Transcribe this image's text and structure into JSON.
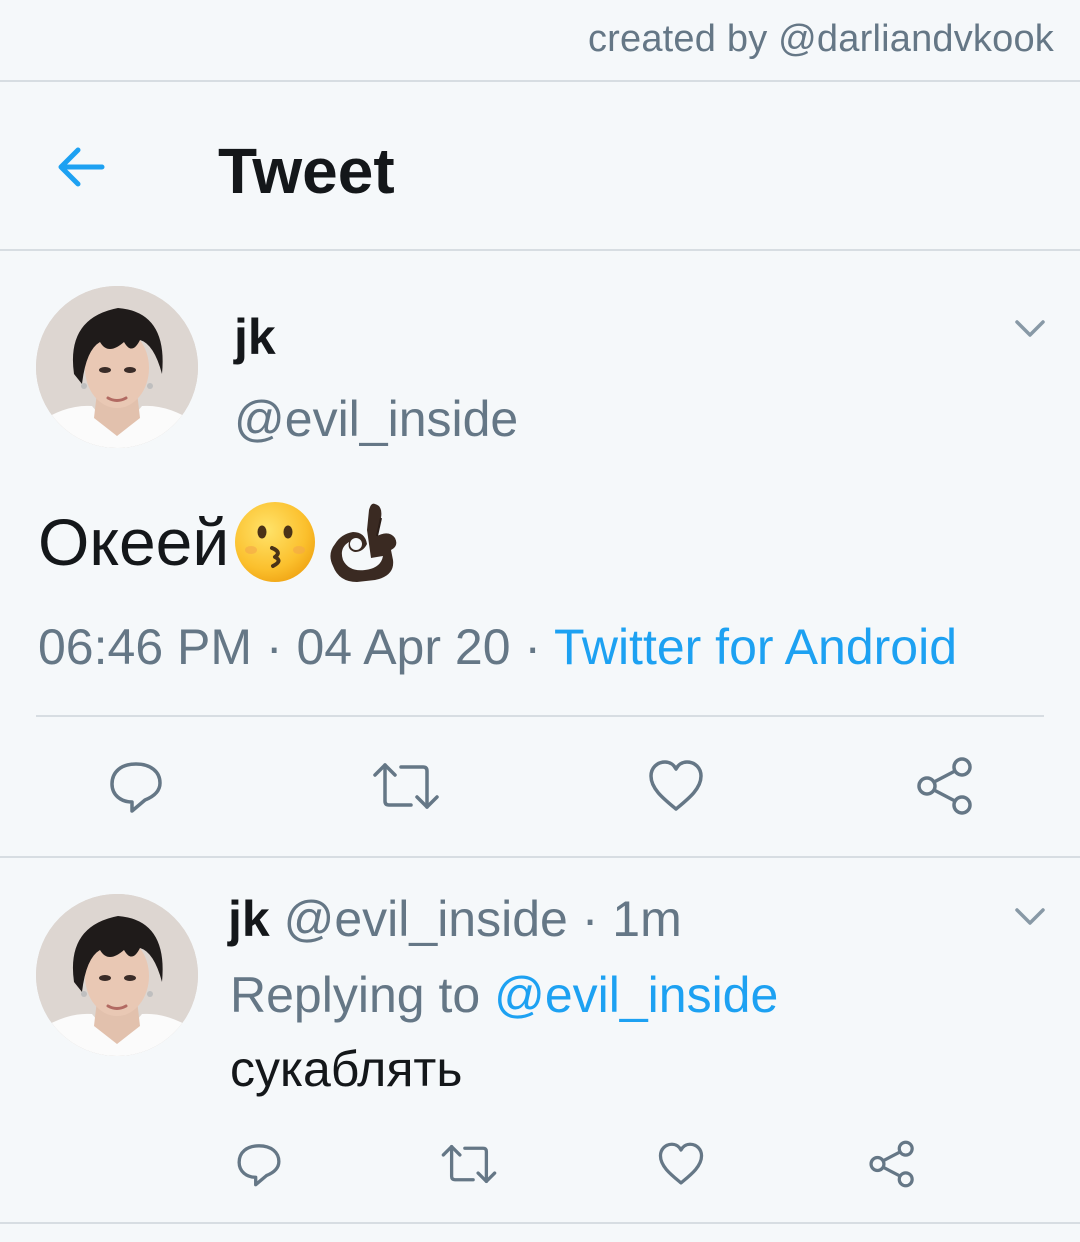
{
  "credit": "created by @darliandvkook",
  "header": {
    "title": "Tweet"
  },
  "tweet": {
    "author_name": "jk",
    "author_handle": "@evil_inside",
    "text": "Океей",
    "emoji": [
      "kissing-face",
      "ok-hand-dark"
    ],
    "time": "06:46 PM",
    "date": "04 Apr 20",
    "source": "Twitter for Android"
  },
  "reply": {
    "author_name": "jk",
    "author_handle": "@evil_inside",
    "age": "1m",
    "replying_label": "Replying to",
    "replying_to": "@evil_inside",
    "text": "сукаблять"
  },
  "colors": {
    "accent": "#1da1f2",
    "muted": "#657786",
    "background": "#f5f8fa",
    "divider": "#d7dde2"
  },
  "icons": {
    "back": "arrow-left-icon",
    "menu": "chevron-down-icon",
    "actions": [
      "reply-icon",
      "retweet-icon",
      "like-icon",
      "share-icon"
    ]
  }
}
